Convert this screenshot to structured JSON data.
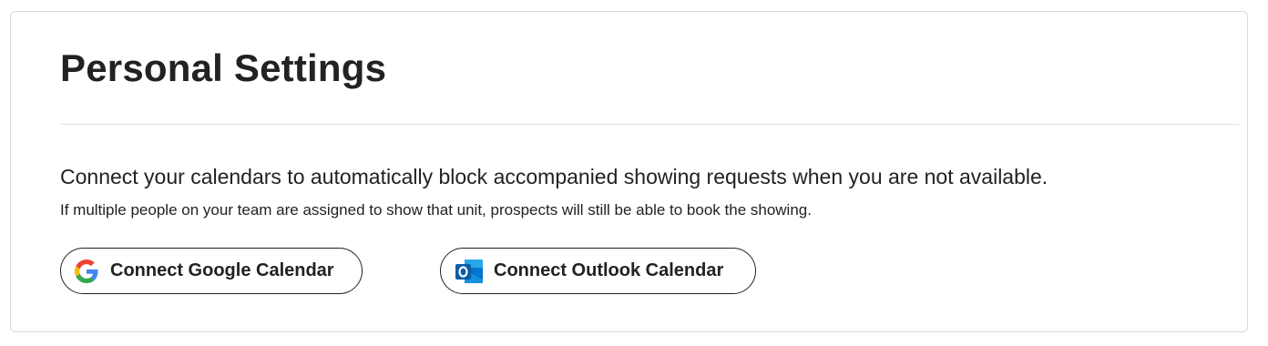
{
  "page": {
    "title": "Personal Settings",
    "description": "Connect your calendars to automatically block accompanied showing requests when you are not available.",
    "note": "If multiple people on your team are assigned to show that unit, prospects will still be able to book the showing."
  },
  "buttons": {
    "google": {
      "label": "Connect Google Calendar",
      "icon": "google-icon"
    },
    "outlook": {
      "label": "Connect Outlook Calendar",
      "icon": "outlook-icon"
    }
  },
  "colors": {
    "text": "#222222",
    "border": "#d9d9d9",
    "divider": "#e2e2e2",
    "google_blue": "#4285F4",
    "google_red": "#EA4335",
    "google_yellow": "#FBBC05",
    "google_green": "#34A853",
    "outlook_blue": "#0F6CBD"
  }
}
